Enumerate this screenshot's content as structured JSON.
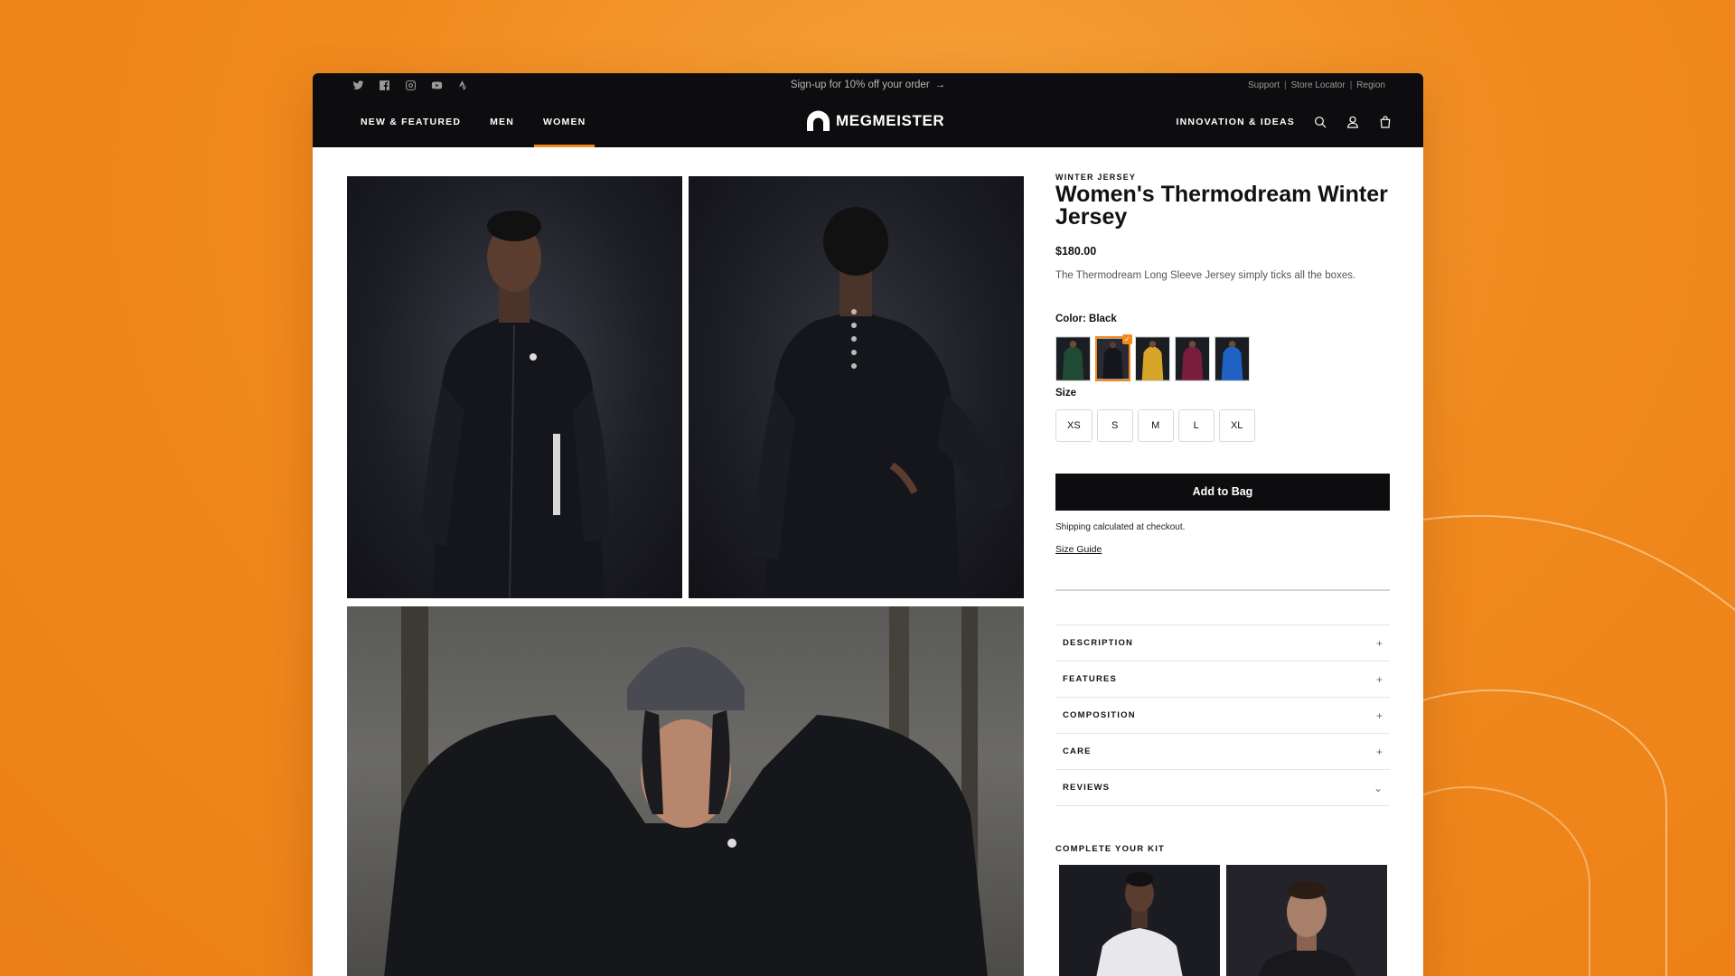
{
  "header": {
    "social_icons": [
      "twitter-icon",
      "facebook-icon",
      "instagram-icon",
      "youtube-icon",
      "strava-icon"
    ],
    "promo_text": "Sign-up for 10% off your order",
    "utility_links": [
      "Support",
      "Store Locator",
      "Region"
    ],
    "nav_items": [
      "NEW & FEATURED",
      "MEN",
      "WOMEN"
    ],
    "active_nav": "WOMEN",
    "brand": "MEGMEISTER",
    "right_link": "INNOVATION & IDEAS",
    "icons": [
      "search-icon",
      "account-icon",
      "bag-icon"
    ],
    "accent_color": "#f28a1c"
  },
  "product": {
    "eyebrow": "WINTER JERSEY",
    "title": "Women's Thermodream Winter Jersey",
    "price": "$180.00",
    "description": "The Thermodream Long Sleeve Jersey simply ticks all the boxes.",
    "color_label": "Color: Black",
    "colors": [
      {
        "name": "Green",
        "hex": "#1f4a33"
      },
      {
        "name": "Black",
        "hex": "#1a1b22",
        "selected": true
      },
      {
        "name": "Yellow",
        "hex": "#d7a628"
      },
      {
        "name": "Burgundy",
        "hex": "#7a1d3c"
      },
      {
        "name": "Blue",
        "hex": "#1f62c4"
      }
    ],
    "size_label": "Size",
    "sizes": [
      "XS",
      "S",
      "M",
      "L",
      "XL"
    ],
    "add_to_bag": "Add to Bag",
    "shipping_note": "Shipping calculated at checkout.",
    "size_guide": "Size Guide",
    "accordion": [
      {
        "label": "DESCRIPTION",
        "icon": "+"
      },
      {
        "label": "FEATURES",
        "icon": "+"
      },
      {
        "label": "COMPOSITION",
        "icon": "+"
      },
      {
        "label": "CARE",
        "icon": "+"
      },
      {
        "label": "REVIEWS",
        "icon": "⌄"
      }
    ],
    "kit_heading": "COMPLETE YOUR KIT"
  }
}
